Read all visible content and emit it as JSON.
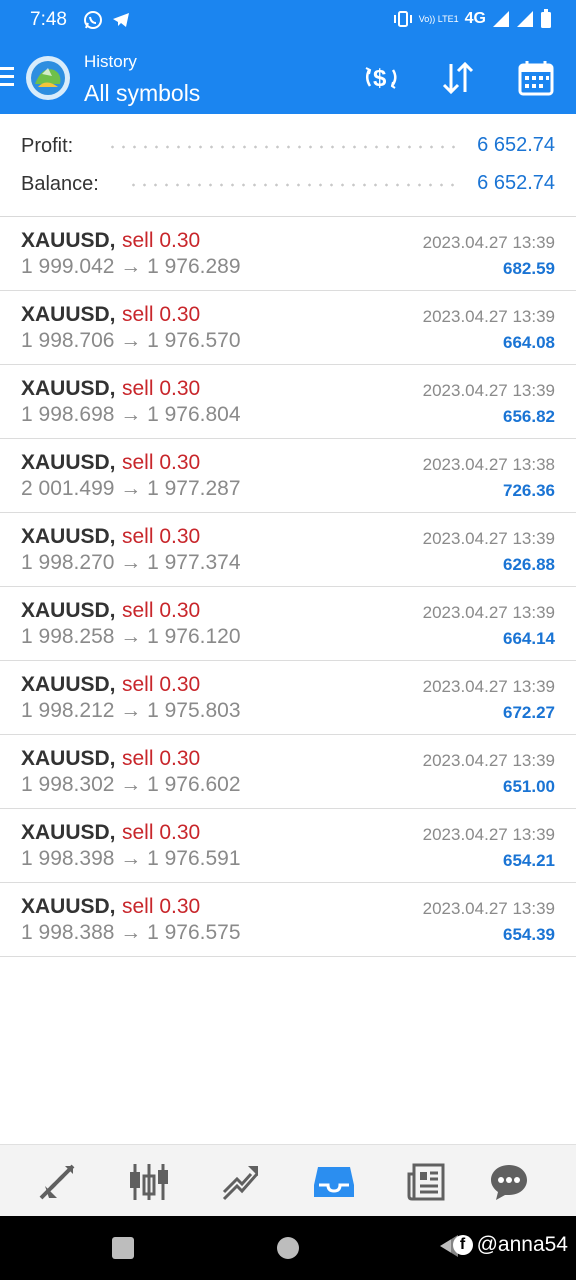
{
  "status_bar": {
    "time": "7:48",
    "network": "4G",
    "volte": "Vo)) LTE1"
  },
  "app_bar": {
    "subtitle": "History",
    "title": "All symbols",
    "icons": [
      "menu-icon",
      "currency-exchange-icon",
      "sort-icon",
      "calendar-icon"
    ]
  },
  "summary": {
    "profit_label": "Profit:",
    "profit_value": "6 652.74",
    "balance_label": "Balance:",
    "balance_value": "6 652.74"
  },
  "trades": [
    {
      "symbol": "XAUUSD,",
      "side": "sell 0.30",
      "prices": "1 999.042 → 1 976.289",
      "time": "2023.04.27 13:39",
      "profit": "682.59"
    },
    {
      "symbol": "XAUUSD,",
      "side": "sell 0.30",
      "prices": "1 998.706 → 1 976.570",
      "time": "2023.04.27 13:39",
      "profit": "664.08"
    },
    {
      "symbol": "XAUUSD,",
      "side": "sell 0.30",
      "prices": "1 998.698 → 1 976.804",
      "time": "2023.04.27 13:39",
      "profit": "656.82"
    },
    {
      "symbol": "XAUUSD,",
      "side": "sell 0.30",
      "prices": "2 001.499 → 1 977.287",
      "time": "2023.04.27 13:38",
      "profit": "726.36"
    },
    {
      "symbol": "XAUUSD,",
      "side": "sell 0.30",
      "prices": "1 998.270 → 1 977.374",
      "time": "2023.04.27 13:39",
      "profit": "626.88"
    },
    {
      "symbol": "XAUUSD,",
      "side": "sell 0.30",
      "prices": "1 998.258 → 1 976.120",
      "time": "2023.04.27 13:39",
      "profit": "664.14"
    },
    {
      "symbol": "XAUUSD,",
      "side": "sell 0.30",
      "prices": "1 998.212 → 1 975.803",
      "time": "2023.04.27 13:39",
      "profit": "672.27"
    },
    {
      "symbol": "XAUUSD,",
      "side": "sell 0.30",
      "prices": "1 998.302 → 1 976.602",
      "time": "2023.04.27 13:39",
      "profit": "651.00"
    },
    {
      "symbol": "XAUUSD,",
      "side": "sell 0.30",
      "prices": "1 998.398 → 1 976.591",
      "time": "2023.04.27 13:39",
      "profit": "654.21"
    },
    {
      "symbol": "XAUUSD,",
      "side": "sell 0.30",
      "prices": "1 998.388 → 1 976.575",
      "time": "2023.04.27 13:39",
      "profit": "654.39"
    }
  ],
  "bottom_nav": [
    {
      "name": "quotes-icon",
      "active": false
    },
    {
      "name": "chart-candles-icon",
      "active": false
    },
    {
      "name": "trade-icon",
      "active": false
    },
    {
      "name": "history-inbox-icon",
      "active": true
    },
    {
      "name": "news-icon",
      "active": false
    },
    {
      "name": "chat-icon",
      "active": false
    }
  ],
  "watermark": {
    "handle": "@anna54"
  },
  "colors": {
    "accent": "#1b85f0",
    "sell": "#c8262b",
    "profit": "#1a74d4",
    "muted": "#8a8a8a"
  }
}
